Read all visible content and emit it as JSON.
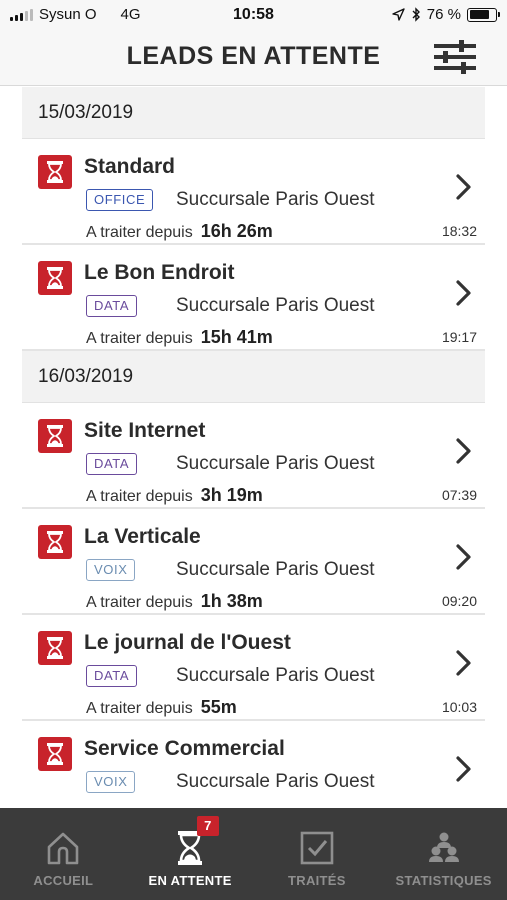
{
  "status_bar": {
    "carrier": "Sysun O",
    "network": "4G",
    "time": "10:58",
    "battery": "76 %",
    "battery_level": 0.76
  },
  "header": {
    "title": "LEADS EN ATTENTE",
    "filter_icon": "sliders-icon"
  },
  "groups": [
    {
      "date": "15/03/2019",
      "leads": [
        {
          "name": "Standard",
          "tag": "OFFICE",
          "branch": "Succursale Paris Ouest",
          "waiting_label": "A traiter depuis",
          "waiting": "16h 26m",
          "time": "18:32"
        },
        {
          "name": "Le Bon Endroit",
          "tag": "DATA",
          "branch": "Succursale Paris Ouest",
          "waiting_label": "A traiter depuis",
          "waiting": "15h 41m",
          "time": "19:17"
        }
      ]
    },
    {
      "date": "16/03/2019",
      "leads": [
        {
          "name": "Site Internet",
          "tag": "DATA",
          "branch": "Succursale Paris Ouest",
          "waiting_label": "A traiter depuis",
          "waiting": "3h 19m",
          "time": "07:39"
        },
        {
          "name": "La Verticale",
          "tag": "VOIX",
          "branch": "Succursale Paris Ouest",
          "waiting_label": "A traiter depuis",
          "waiting": "1h 38m",
          "time": "09:20"
        },
        {
          "name": "Le journal de l'Ouest",
          "tag": "DATA",
          "branch": "Succursale Paris Ouest",
          "waiting_label": "A traiter depuis",
          "waiting": "55m",
          "time": "10:03"
        },
        {
          "name": "Service Commercial",
          "tag": "VOIX",
          "branch": "Succursale Paris Ouest",
          "waiting_label": "",
          "waiting": "",
          "time": ""
        }
      ]
    }
  ],
  "tabbar": {
    "tabs": [
      {
        "label": "ACCUEIL",
        "icon": "home-icon"
      },
      {
        "label": "EN ATTENTE",
        "icon": "hourglass-icon",
        "badge": "7"
      },
      {
        "label": "TRAITÉS",
        "icon": "checkbox-icon"
      },
      {
        "label": "STATISTIQUES",
        "icon": "people-stats-icon"
      }
    ]
  },
  "colors": {
    "accent_red": "#c8232b",
    "tag_office": "#3b57b0",
    "tag_data": "#6a4b9c",
    "tag_voix": "#6a8cb0",
    "tabbar_bg": "#3b3b3b"
  }
}
